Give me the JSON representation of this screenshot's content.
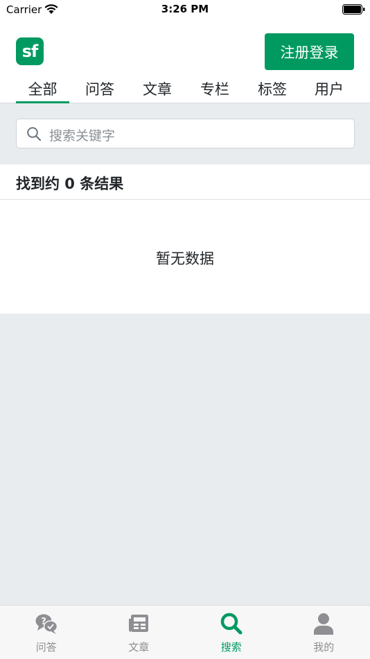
{
  "status_bar": {
    "carrier": "Carrier",
    "time": "3:26 PM"
  },
  "header": {
    "logo_text": "sf",
    "login_label": "注册登录",
    "tabs": [
      {
        "label": "全部",
        "active": true
      },
      {
        "label": "问答"
      },
      {
        "label": "文章"
      },
      {
        "label": "专栏"
      },
      {
        "label": "标签"
      },
      {
        "label": "用户"
      }
    ]
  },
  "search": {
    "placeholder": "搜索关键字"
  },
  "results": {
    "count_text": "找到约 0 条结果",
    "empty_text": "暂无数据"
  },
  "tabbar": {
    "items": [
      {
        "label": "问答",
        "icon": "qa-bubble-icon"
      },
      {
        "label": "文章",
        "icon": "newspaper-icon"
      },
      {
        "label": "搜索",
        "icon": "search-icon",
        "active": true
      },
      {
        "label": "我的",
        "icon": "user-icon"
      }
    ]
  },
  "colors": {
    "accent": "#009a61",
    "inactive": "#8e8e93",
    "background": "#e9ecef"
  }
}
